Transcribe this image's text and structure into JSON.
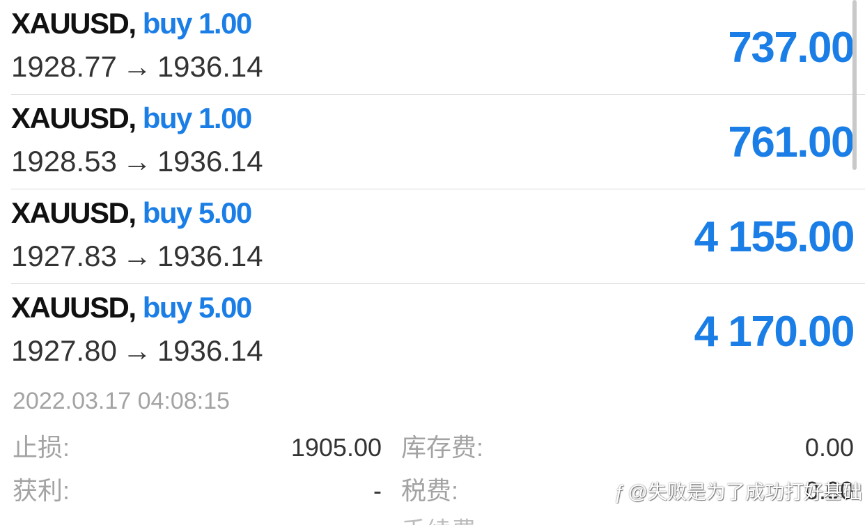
{
  "positions": [
    {
      "symbol": "XAUUSD,",
      "type": "buy",
      "volume": "1.00",
      "open_price": "1928.77",
      "arrow": "→",
      "current_price": "1936.14",
      "profit": "737.00"
    },
    {
      "symbol": "XAUUSD,",
      "type": "buy",
      "volume": "1.00",
      "open_price": "1928.53",
      "arrow": "→",
      "current_price": "1936.14",
      "profit": "761.00"
    },
    {
      "symbol": "XAUUSD,",
      "type": "buy",
      "volume": "5.00",
      "open_price": "1927.83",
      "arrow": "→",
      "current_price": "1936.14",
      "profit": "4 155.00"
    },
    {
      "symbol": "XAUUSD,",
      "type": "buy",
      "volume": "5.00",
      "open_price": "1927.80",
      "arrow": "→",
      "current_price": "1936.14",
      "profit": "4 170.00"
    }
  ],
  "details": {
    "timestamp": "2022.03.17 04:08:15",
    "stop_loss_label": "止损:",
    "stop_loss_value": "1905.00",
    "take_profit_label": "获利:",
    "take_profit_value": "-",
    "swap_label": "库存费:",
    "swap_value": "0.00",
    "taxes_label": "税费:",
    "taxes_value": "0.00",
    "commission_label": "手续费:"
  },
  "watermark": {
    "icon": "zhihu-logo-icon",
    "text": "@失败是为了成功打好基础"
  },
  "colors": {
    "accent": "#1a7ee6",
    "text_dark": "#111111",
    "text_secondary": "#333333",
    "text_muted": "#a3a3a3",
    "divider": "#d9d9d9"
  }
}
